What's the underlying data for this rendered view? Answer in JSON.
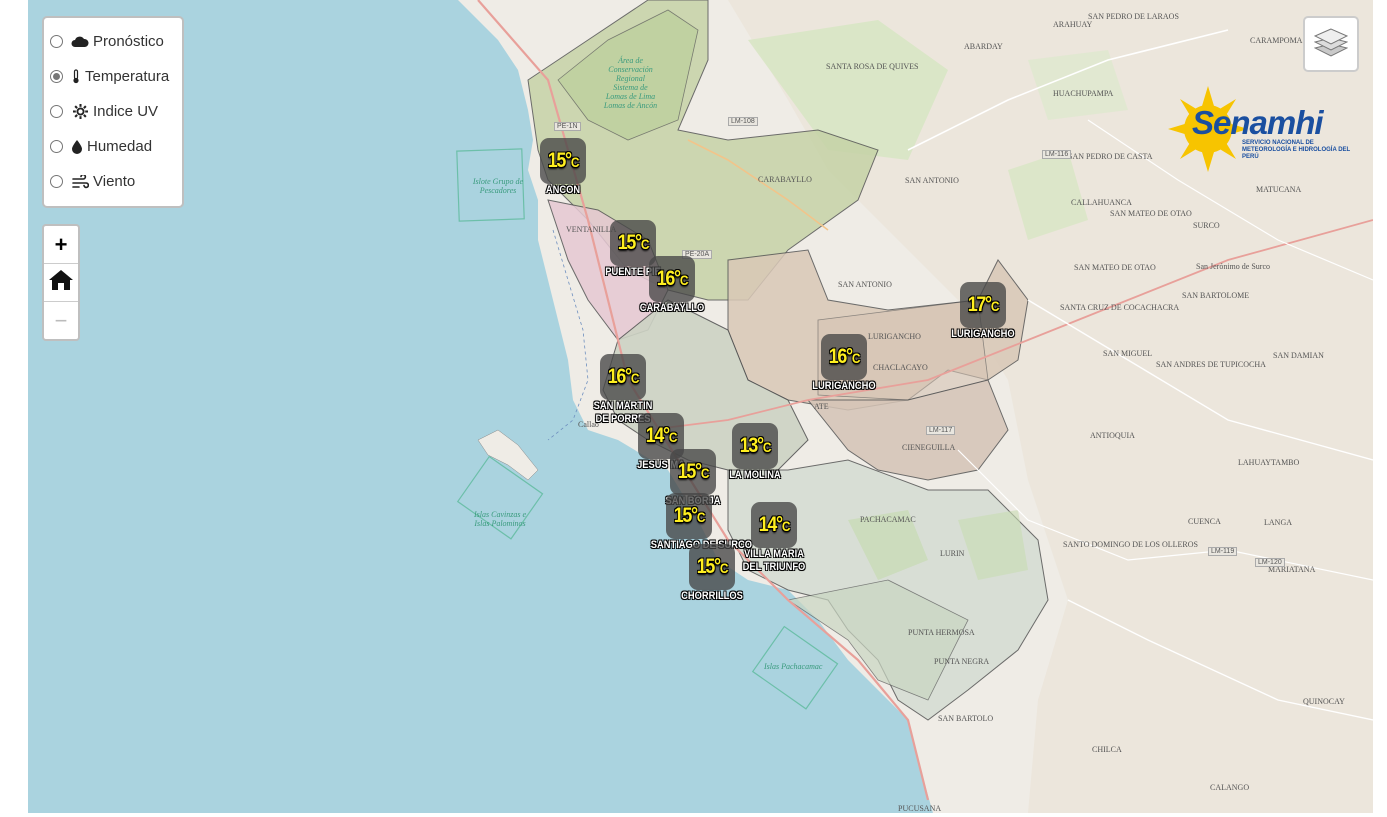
{
  "map_layers": {
    "options": [
      {
        "label": "Pronóstico",
        "icon": "cloud-icon",
        "checked": false
      },
      {
        "label": "Temperatura",
        "icon": "thermometer-icon",
        "checked": true
      },
      {
        "label": "Indice UV",
        "icon": "sun-icon",
        "checked": false
      },
      {
        "label": "Humedad",
        "icon": "droplet-icon",
        "checked": false
      },
      {
        "label": "Viento",
        "icon": "wind-icon",
        "checked": false
      }
    ]
  },
  "zoom_controls": {
    "zoom_in": "+",
    "zoom_out": "−",
    "home_icon": "home-icon"
  },
  "layers_button": {
    "icon": "layers-icon"
  },
  "logo": {
    "brand": "Senamhi",
    "subtitle": "SERVICIO NACIONAL DE METEOROLOGÍA E HIDROLOGÍA DEL PERÚ"
  },
  "markers": [
    {
      "temp": "15°",
      "unit": "C",
      "name": "ANCON"
    },
    {
      "temp": "15°",
      "unit": "C",
      "name": "PUENTE PIE"
    },
    {
      "temp": "16°",
      "unit": "C",
      "name": "CARABAYLLO"
    },
    {
      "temp": "17°",
      "unit": "C",
      "name": "LURIGANCHO"
    },
    {
      "temp": "16°",
      "unit": "C",
      "name": "LURIGANCHO"
    },
    {
      "temp": "16°",
      "unit": "C",
      "name": "SAN MARTIN DE PORRES"
    },
    {
      "temp": "14°",
      "unit": "C",
      "name": "JESUS MA"
    },
    {
      "temp": "13°",
      "unit": "C",
      "name": "LA MOLINA"
    },
    {
      "temp": "15°",
      "unit": "C",
      "name": "SAN BORJA"
    },
    {
      "temp": "15°",
      "unit": "C",
      "name": "SANTIAGO DE SURCO"
    },
    {
      "temp": "14°",
      "unit": "C",
      "name": "VILLA MARIA DEL TRIUNFO"
    },
    {
      "temp": "15°",
      "unit": "C",
      "name": "CHORRILLOS"
    }
  ],
  "place_labels": [
    "SAN PEDRO DE LARAOS",
    "ARAHUAY",
    "CARAMPOMA",
    "ABARDAY",
    "SANTA ROSA DE QUIVES",
    "HUACHUPAMPA",
    "SAN PEDRO DE CASTA",
    "SAN ANTONIO",
    "CALLAHUANCA",
    "SAN MATEO DE OTAO",
    "MATUCANA",
    "SURCO",
    "SAN MATEO DE OTAO",
    "San Jerónimo de Surco",
    "SAN BARTOLOME",
    "SANTA CRUZ DE COCACHACRA",
    "SAN ANTONIO",
    "LURIGANCHO",
    "CHACLACAYO",
    "SAN DAMIAN",
    "SAN ANDRES DE TUPICOCHA",
    "SAN MIGUEL",
    "ANTIOQUIA",
    "CIENEGUILLA",
    "LAHUAYTAMBO",
    "LANGA",
    "CUENCA",
    "SANTO DOMINGO DE LOS OLLEROS",
    "MARIATANA",
    "PACHACAMAC",
    "LURIN",
    "PUNTA HERMOSA",
    "PUNTA NEGRA",
    "SAN BARTOLO",
    "QUINOCAY",
    "CHILCA",
    "CALANGO",
    "PUCUSANA",
    "CARABAYLLO",
    "VENTANILLA",
    "Callao",
    "ATE",
    "Islote Grupo de Pescadores",
    "Islas Cavinzas e Islas Palominos",
    "Islas Pachacamac",
    "Área de Conservación Regional Sistema de Lomas de Lima Lomas de Ancón"
  ],
  "road_labels": [
    "LM-108",
    "LM-116",
    "PE-1N",
    "PE-20A",
    "LM-117",
    "LM-119",
    "LM-120"
  ]
}
